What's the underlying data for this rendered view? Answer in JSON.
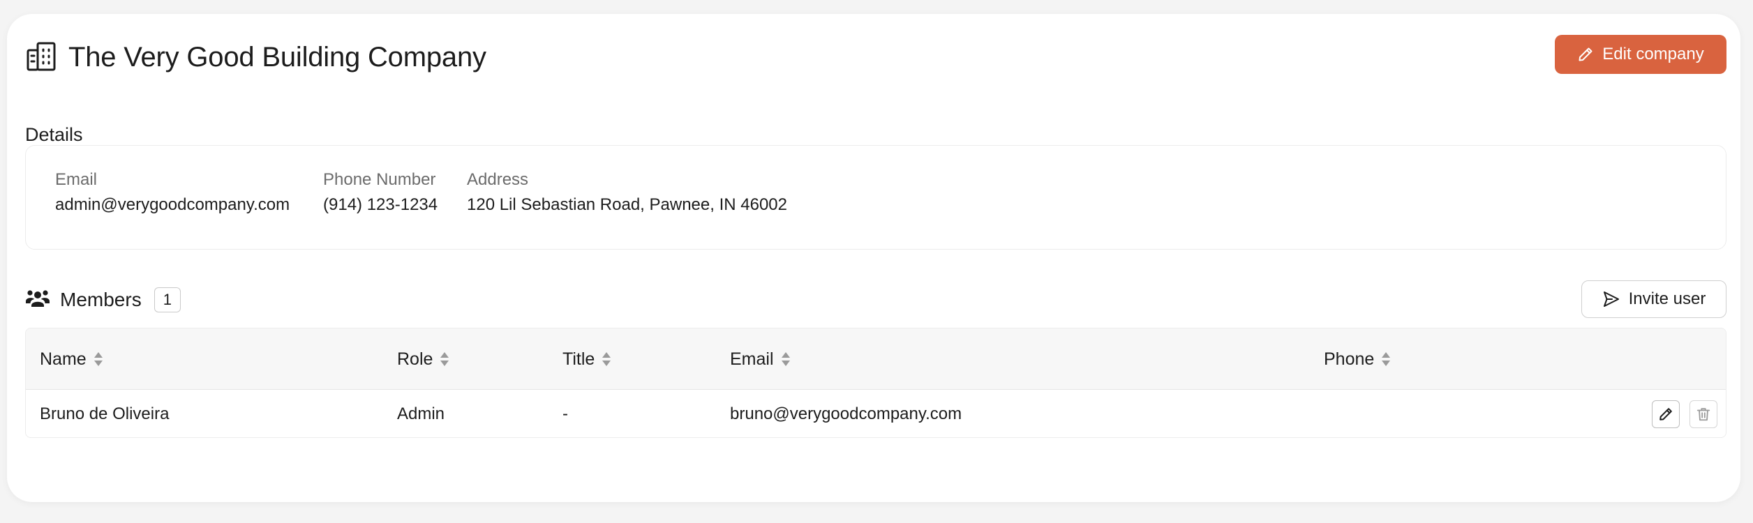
{
  "company": {
    "title": "The Very Good Building Company",
    "edit_label": "Edit company"
  },
  "details": {
    "section_label": "Details",
    "email_label": "Email",
    "email_value": "admin@verygoodcompany.com",
    "phone_label": "Phone Number",
    "phone_value": "(914) 123-1234",
    "address_label": "Address",
    "address_value": "120 Lil Sebastian Road, Pawnee, IN 46002"
  },
  "members": {
    "title": "Members",
    "count": "1",
    "invite_label": "Invite user",
    "columns": [
      "Name",
      "Role",
      "Title",
      "Email",
      "Phone"
    ],
    "rows": [
      {
        "name": "Bruno de Oliveira",
        "role": "Admin",
        "title": "-",
        "email": "bruno@verygoodcompany.com",
        "phone": ""
      }
    ]
  },
  "icons": {
    "company": "building-icon",
    "edit": "pencil-icon",
    "members": "users-icon",
    "invite": "send-icon",
    "sort": "sort-icon",
    "delete": "trash-icon"
  },
  "colors": {
    "accent": "#d9633f",
    "text": "#1c1c1c",
    "muted": "#6b6b6b",
    "border": "#ececec",
    "header_bg": "#f7f7f7"
  }
}
